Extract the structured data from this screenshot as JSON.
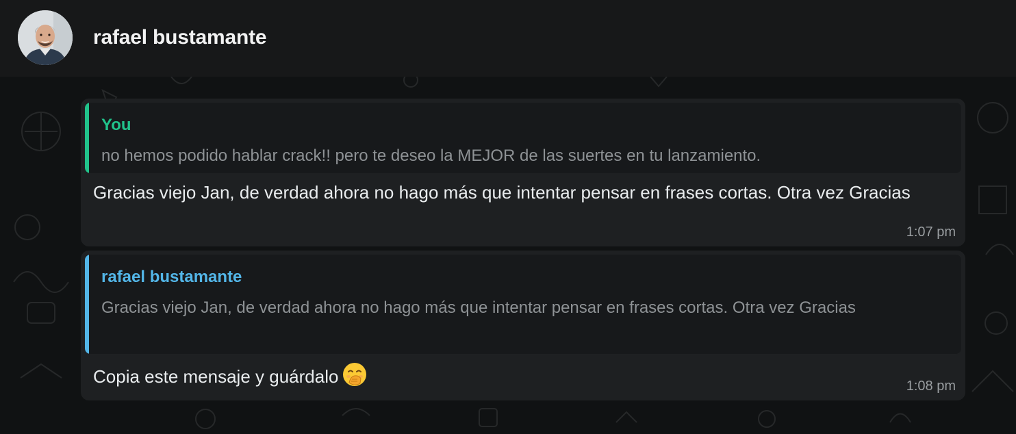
{
  "header": {
    "contact_name": "rafael bustamante",
    "avatar_icon": "profile-photo"
  },
  "messages": [
    {
      "quote": {
        "author": "You",
        "author_color": "#21c38b",
        "text": "no hemos podido hablar crack!! pero te deseo la MEJOR de las suertes en tu lanzamiento."
      },
      "text": "Gracias viejo Jan, de verdad ahora no hago más que intentar pensar en frases cortas. Otra vez Gracias",
      "time": "1:07 pm"
    },
    {
      "quote": {
        "author": "rafael bustamante",
        "author_color": "#53b6e8",
        "text": "Gracias viejo Jan, de verdad ahora no hago más que intentar pensar en frases cortas. Otra vez Gracias"
      },
      "text": "Copia este mensaje y guárdalo",
      "emoji": "face-with-hand-over-mouth",
      "time": "1:08 pm"
    }
  ]
}
